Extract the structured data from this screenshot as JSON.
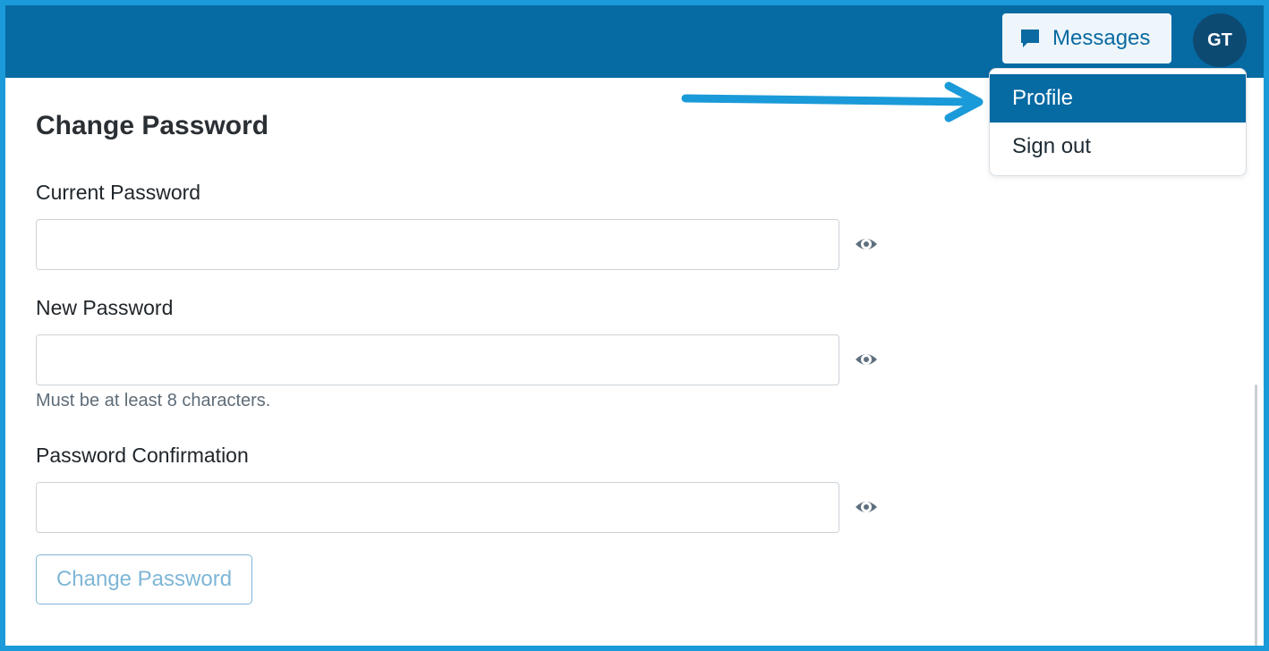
{
  "header": {
    "messages_label": "Messages",
    "messages_icon": "chat-bubble-icon",
    "avatar_initials": "GT",
    "bar_color": "#066aa3"
  },
  "user_menu": {
    "items": [
      {
        "label": "Profile",
        "active": true
      },
      {
        "label": "Sign out",
        "active": false
      }
    ]
  },
  "annotation": {
    "arrow_color": "#1a9ad8",
    "icon": "pointer-arrow-icon"
  },
  "form": {
    "title": "Change Password",
    "fields": [
      {
        "label": "Current Password",
        "value": "",
        "placeholder": "",
        "toggle_icon": "eye-icon"
      },
      {
        "label": "New Password",
        "value": "",
        "placeholder": "",
        "toggle_icon": "eye-icon",
        "help": "Must be at least 8 characters."
      },
      {
        "label": "Password Confirmation",
        "value": "",
        "placeholder": "",
        "toggle_icon": "eye-icon"
      }
    ],
    "submit_label": "Change Password",
    "submit_enabled": false
  }
}
